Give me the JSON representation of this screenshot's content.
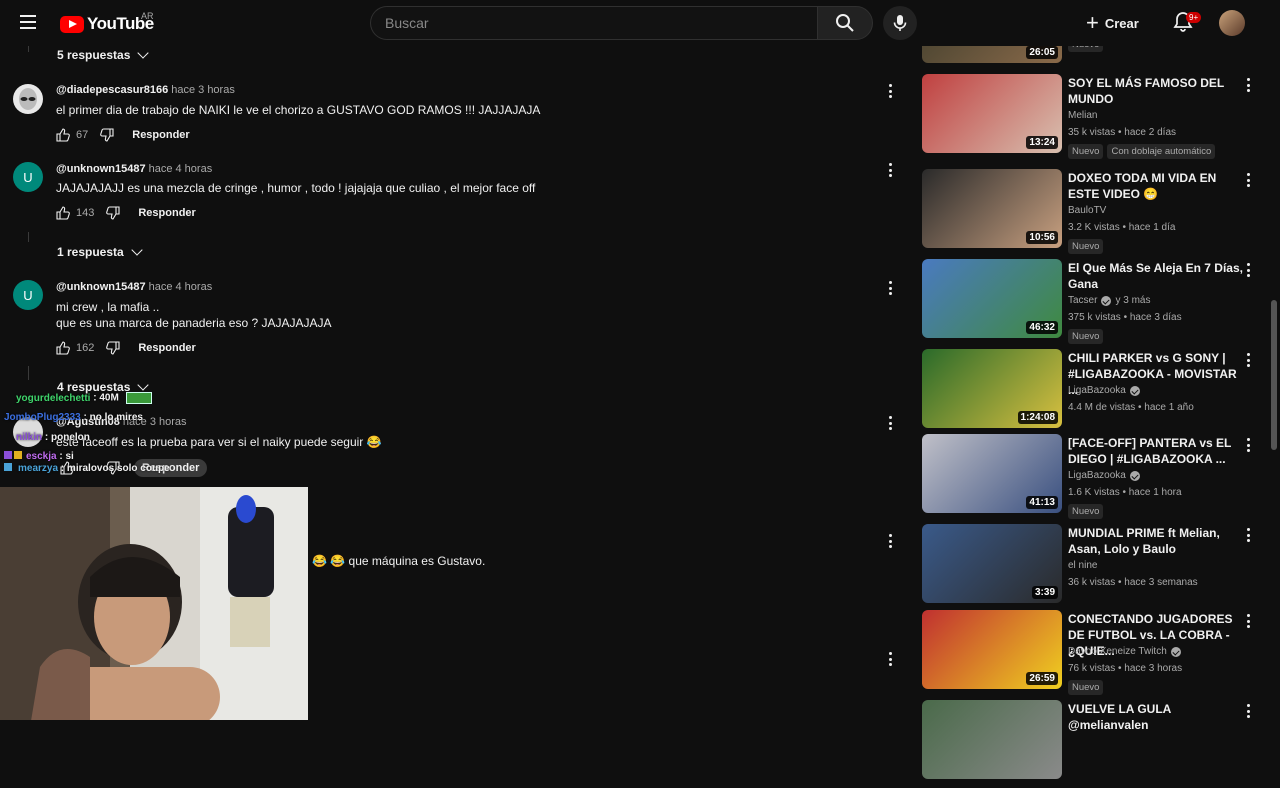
{
  "header": {
    "logo_text": "YouTube",
    "country": "AR",
    "search_placeholder": "Buscar",
    "create_label": "Crear",
    "notification_count": "9+"
  },
  "comments": {
    "replies_toggles": [
      "5 respuestas",
      "1 respuesta",
      "4 respuestas"
    ],
    "items": [
      {
        "author": "@diadepescasur8166",
        "time": "hace 3 horas",
        "lines": [
          "el primer dia de trabajo de NAIKI le ve el chorizo a GUSTAVO GOD RAMOS !!! JAJJAJAJA"
        ],
        "likes": "67",
        "reply": "Responder",
        "avatar_letter": ""
      },
      {
        "author": "@unknown15487",
        "time": "hace 4 horas",
        "lines": [
          "JAJAJAJAJJ es una mezcla de cringe , humor , todo ! jajajaja que culiao , el mejor face off"
        ],
        "likes": "143",
        "reply": "Responder",
        "avatar_letter": "U"
      },
      {
        "author": "@unknown15487",
        "time": "hace 4 horas",
        "lines": [
          "mi crew , la mafia ..",
          "que es una marca de panaderia eso ? JAJAJAJAJA"
        ],
        "likes": "162",
        "reply": "Responder",
        "avatar_letter": "U"
      },
      {
        "author": "@Agustin08",
        "time": "hace 3 horas",
        "lines": [
          "este faceoff es la prueba para ver si el naiky puede seguir 😂"
        ],
        "likes": "",
        "reply": "Responder",
        "avatar_letter": ""
      }
    ],
    "partial_comment": "😂 😂 que máquina es Gustavo."
  },
  "chat": [
    {
      "user": "yogurdelechetti",
      "msg": "40M",
      "color": "#3fd46b"
    },
    {
      "user": "JomboPlug2333",
      "msg": "no lo mires",
      "color": "#3b6fe0"
    },
    {
      "user": "nilkin",
      "msg": "ponelon",
      "color": "#8a4fd8"
    },
    {
      "user": "esckja",
      "msg": "si",
      "color": "#c06cf0"
    },
    {
      "user": "mearzya",
      "msg": "miralovos solo coupe",
      "color": "#4aa3d8"
    }
  ],
  "sidebar": {
    "videos": [
      {
        "title": "",
        "channel": "",
        "meta": "",
        "duration": "26:05",
        "badges": [
          "Nuevo"
        ],
        "verified": false,
        "thumb_colors": [
          "#3a3a2a",
          "#8a6a4a"
        ]
      },
      {
        "title": "SOY EL MÁS FAMOSO DEL MUNDO",
        "channel": "Melian",
        "meta": "35 k vistas • hace 2 días",
        "duration": "13:24",
        "badges": [
          "Nuevo",
          "Con doblaje automático"
        ],
        "verified": false,
        "thumb_colors": [
          "#c04040",
          "#d8c0b0"
        ]
      },
      {
        "title": "DOXEO TODA MI VIDA EN ESTE VIDEO 😁",
        "channel": "BauloTV",
        "meta": "3.2 K vistas • hace 1 día",
        "duration": "10:56",
        "badges": [
          "Nuevo"
        ],
        "verified": false,
        "thumb_colors": [
          "#2a2a2a",
          "#c8a080"
        ]
      },
      {
        "title": "El Que Más Se Aleja En 7 Días, Gana",
        "channel": "Tacser",
        "channel_suffix": "y 3 más",
        "meta": "375 k vistas • hace 3 días",
        "duration": "46:32",
        "badges": [
          "Nuevo"
        ],
        "verified": true,
        "thumb_colors": [
          "#4a7ac0",
          "#3f8a3f"
        ]
      },
      {
        "title": "CHILI PARKER vs G SONY | #LIGABAZOOKA - MOVISTAR ...",
        "channel": "LigaBazooka",
        "meta": "4.4 M de vistas • hace 1 año",
        "duration": "1:24:08",
        "badges": [],
        "verified": true,
        "thumb_colors": [
          "#2a6a2a",
          "#d8c040"
        ]
      },
      {
        "title": "[FACE-OFF] PANTERA vs EL DIEGO | #LIGABAZOOKA ...",
        "channel": "LigaBazooka",
        "meta": "1.6 K vistas • hace 1 hora",
        "duration": "41:13",
        "badges": [
          "Nuevo"
        ],
        "verified": true,
        "thumb_colors": [
          "#c0c0c8",
          "#3a5080"
        ]
      },
      {
        "title": "MUNDIAL PRIME ft Melian, Asan, Lolo y Baulo",
        "channel": "el nine",
        "meta": "36 k vistas • hace 3 semanas",
        "duration": "3:39",
        "badges": [],
        "verified": false,
        "thumb_colors": [
          "#3a5a8a",
          "#2a2a2a"
        ]
      },
      {
        "title": "CONECTANDO JUGADORES DE FUTBOL vs. LA COBRA - ¿QUIE...",
        "channel": "Davoo Xeneize Twitch",
        "meta": "76 k vistas • hace 3 horas",
        "duration": "26:59",
        "badges": [
          "Nuevo"
        ],
        "verified": true,
        "thumb_colors": [
          "#c03030",
          "#f0d020"
        ]
      },
      {
        "title": "VUELVE LA GULA @melianvalen",
        "channel": "",
        "meta": "",
        "duration": "",
        "badges": [],
        "verified": false,
        "thumb_colors": [
          "#4a6a4a",
          "#8a8a8a"
        ]
      }
    ]
  }
}
